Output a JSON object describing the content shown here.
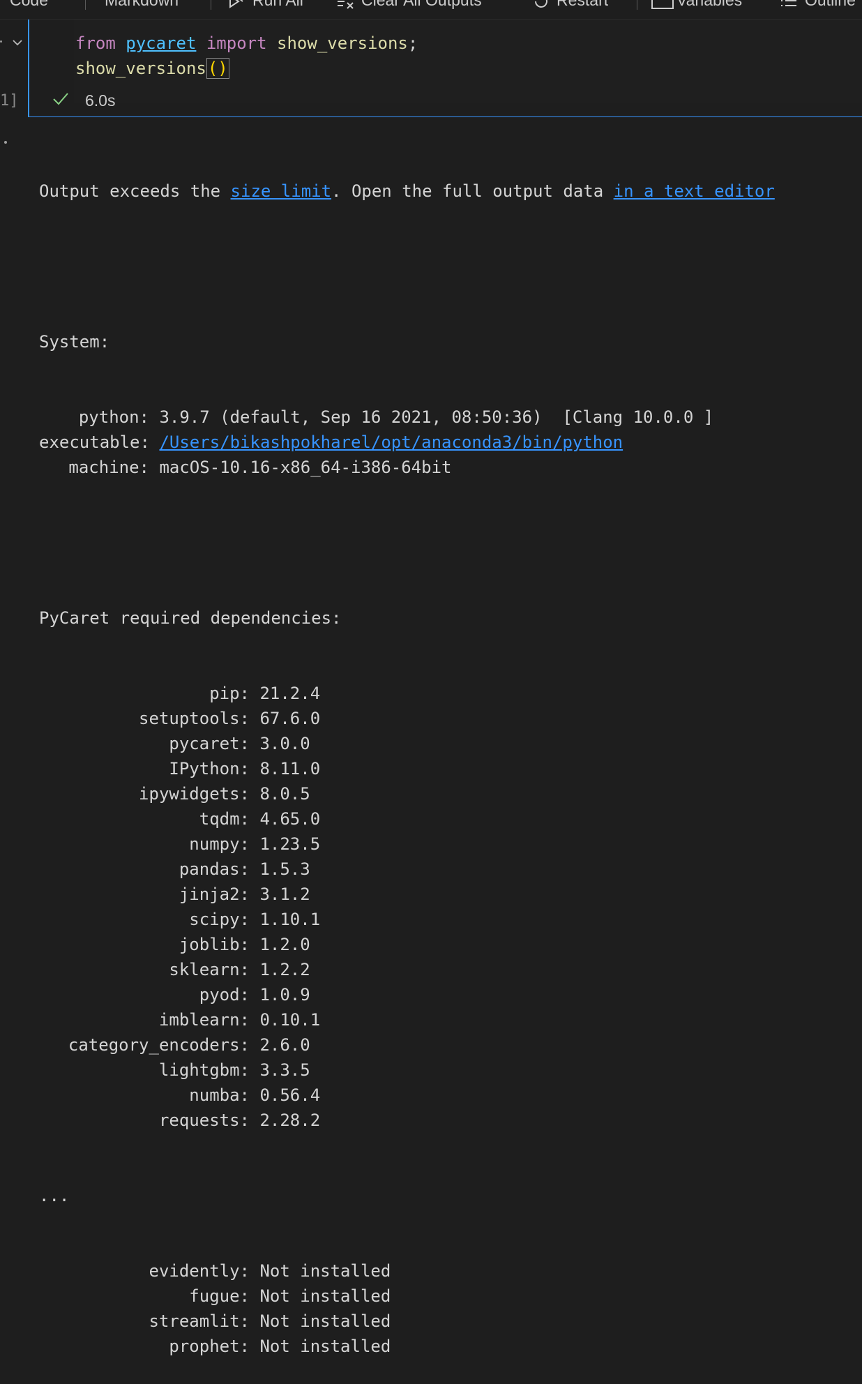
{
  "toolbar": {
    "items": [
      {
        "label": "Code",
        "icon": "plus-icon"
      },
      {
        "label": "Markdown",
        "icon": "plus-icon"
      },
      {
        "label": "Run All",
        "icon": "run-all-icon"
      },
      {
        "label": "Clear All Outputs",
        "icon": "clear-outputs-icon"
      },
      {
        "label": "Restart",
        "icon": "restart-icon"
      },
      {
        "label": "Variables",
        "icon": "variables-icon"
      },
      {
        "label": "Outline",
        "icon": "outline-icon"
      }
    ]
  },
  "cell": {
    "execution_count": "1]",
    "code": {
      "line1": {
        "kw1": "from",
        "module": "pycaret",
        "kw2": "import",
        "fn": "show_versions",
        "end": ";"
      },
      "line2": {
        "fn": "show_versions",
        "paren": "()"
      }
    },
    "status_time": "6.0s"
  },
  "output": {
    "notice": {
      "prefix": "Output exceeds the ",
      "link1": "size limit",
      "middle": ". Open the full output data ",
      "link2": "in a text editor"
    },
    "system_header": "System:",
    "system": [
      {
        "key": "python:",
        "value": "3.9.7 (default, Sep 16 2021, 08:50:36)  [Clang 10.0.0 ]",
        "link": false
      },
      {
        "key": "executable:",
        "value": "/Users/bikashpokharel/opt/anaconda3/bin/python",
        "link": true
      },
      {
        "key": "machine:",
        "value": "macOS-10.16-x86_64-i386-64bit",
        "link": false
      }
    ],
    "deps_header": "PyCaret required dependencies:",
    "deps": [
      {
        "key": "pip:",
        "value": "21.2.4"
      },
      {
        "key": "setuptools:",
        "value": "67.6.0"
      },
      {
        "key": "pycaret:",
        "value": "3.0.0"
      },
      {
        "key": "IPython:",
        "value": "8.11.0"
      },
      {
        "key": "ipywidgets:",
        "value": "8.0.5"
      },
      {
        "key": "tqdm:",
        "value": "4.65.0"
      },
      {
        "key": "numpy:",
        "value": "1.23.5"
      },
      {
        "key": "pandas:",
        "value": "1.5.3"
      },
      {
        "key": "jinja2:",
        "value": "3.1.2"
      },
      {
        "key": "scipy:",
        "value": "1.10.1"
      },
      {
        "key": "joblib:",
        "value": "1.2.0"
      },
      {
        "key": "sklearn:",
        "value": "1.2.2"
      },
      {
        "key": "pyod:",
        "value": "1.0.9"
      },
      {
        "key": "imblearn:",
        "value": "0.10.1"
      },
      {
        "key": "category_encoders:",
        "value": "2.6.0"
      },
      {
        "key": "lightgbm:",
        "value": "3.3.5"
      },
      {
        "key": "numba:",
        "value": "0.56.4"
      },
      {
        "key": "requests:",
        "value": "2.28.2"
      }
    ],
    "ellipsis": "...",
    "optional": [
      {
        "key": "evidently:",
        "value": "Not installed"
      },
      {
        "key": "fugue:",
        "value": "Not installed"
      },
      {
        "key": "streamlit:",
        "value": "Not installed"
      },
      {
        "key": "prophet:",
        "value": "Not installed"
      }
    ]
  },
  "colors": {
    "background": "#1e1e1e",
    "accent": "#3794ff",
    "keyword": "#c586c0",
    "function": "#dcdcaa",
    "success": "#89d185"
  }
}
